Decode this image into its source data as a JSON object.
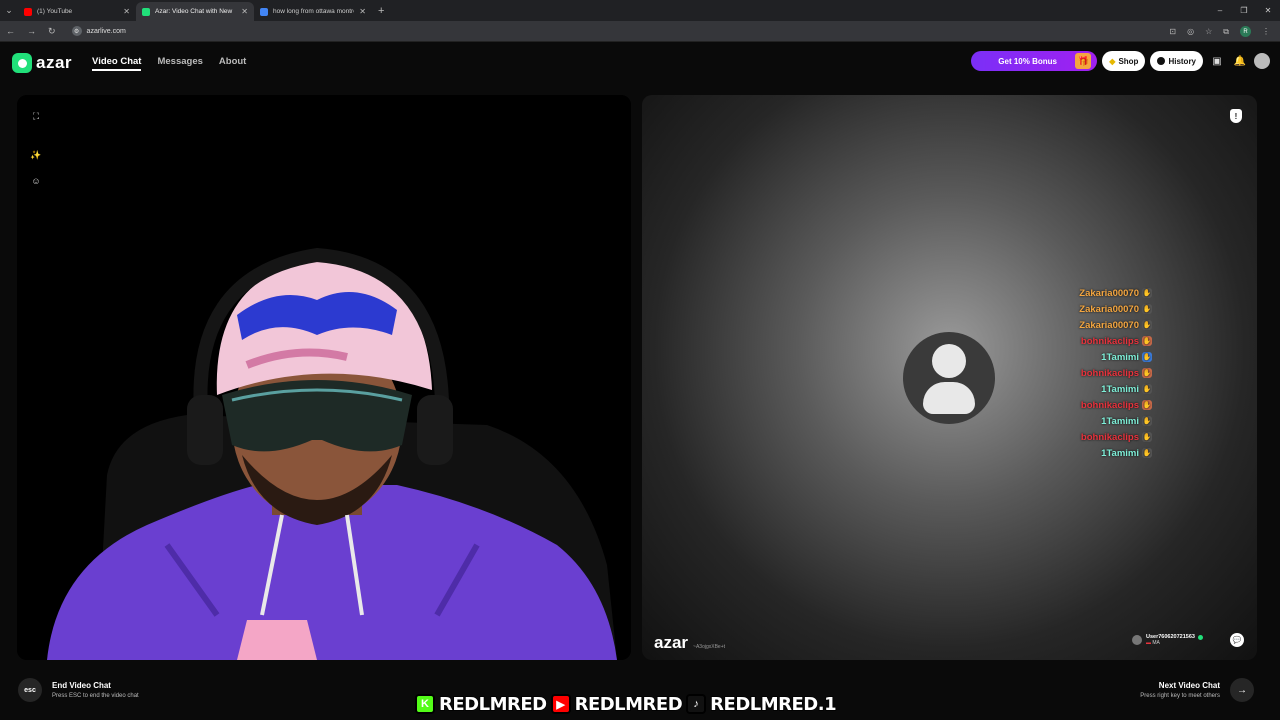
{
  "browser": {
    "tabs": [
      {
        "label": "(1) YouTube",
        "color": "#ff0000",
        "active": false
      },
      {
        "label": "Azar: Video Chat with New",
        "color": "#21e07a",
        "active": true
      },
      {
        "label": "how long from ottawa montre...",
        "color": "#4285f4",
        "active": false
      }
    ],
    "url": "azarlive.com",
    "profile_initial": "R"
  },
  "header": {
    "logo_text": "azar",
    "nav": [
      "Video Chat",
      "Messages",
      "About"
    ],
    "bonus_label": "Get 10% Bonus",
    "shop_label": "Shop",
    "history_label": "History"
  },
  "peer": {
    "watermark_logo": "azar",
    "watermark_id": "~A3ojgxXBe+t",
    "username": "User7606207215​63",
    "country": "MA"
  },
  "chat": [
    {
      "name": "Zakaria00070",
      "color": "#f4a640",
      "emote_color": "#555"
    },
    {
      "name": "Zakaria00070",
      "color": "#f4a640",
      "emote_color": "#555"
    },
    {
      "name": "Zakaria00070",
      "color": "#f4a640",
      "emote_color": "#555"
    },
    {
      "name": "bohnikaclips",
      "color": "#e8323c",
      "emote_color": "#c86a4a"
    },
    {
      "name": "1Tamimi",
      "color": "#7ff0d9",
      "emote_color": "#3b7bd9"
    },
    {
      "name": "bohnikaclips",
      "color": "#e8323c",
      "emote_color": "#c86a4a"
    },
    {
      "name": "1Tamimi",
      "color": "#7ff0d9",
      "emote_color": "#555"
    },
    {
      "name": "bohnikaclips",
      "color": "#e8323c",
      "emote_color": "#c86a4a"
    },
    {
      "name": "1Tamimi",
      "color": "#7ff0d9",
      "emote_color": "#555"
    },
    {
      "name": "bohnikaclips",
      "color": "#e8323c",
      "emote_color": "#555"
    },
    {
      "name": "1Tamimi",
      "color": "#7ff0d9",
      "emote_color": "#555"
    }
  ],
  "footer": {
    "esc_key": "esc",
    "end_title": "End Video Chat",
    "end_sub": "Press ESC to end the video chat",
    "next_title": "Next Video Chat",
    "next_sub": "Press right key to meet others"
  },
  "banner": {
    "handles": [
      "REDLMRED",
      "REDLMRED",
      "REDLMRED.1"
    ],
    "icons": [
      {
        "glyph": "K",
        "bg": "#53fc18",
        "name": "kick-icon"
      },
      {
        "glyph": "▶",
        "bg": "#ff0000",
        "name": "youtube-icon"
      },
      {
        "glyph": "♪",
        "bg": "#111111",
        "name": "tiktok-icon"
      }
    ]
  }
}
